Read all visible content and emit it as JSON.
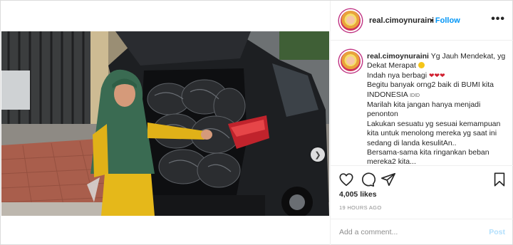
{
  "post": {
    "username": "real.cimoynuraini",
    "follow_separator": "•",
    "follow_label": "Follow",
    "more_icon": "•••",
    "carousel": {
      "slides": 4,
      "active_index": 0,
      "next_icon": "chevron-right-icon"
    }
  },
  "caption": {
    "username": "real.cimoynuraini",
    "line1": "Yg Jauh Mendekat, yg Dekat Merapat",
    "line2": "Indah nya berbagi",
    "line3": "Begitu banyak orng2 baik di BUMI kita INDONESIA",
    "flag_text": "IDID",
    "line4": "Marilah kita jangan hanya menjadi penonton",
    "line5": "Lakukan sesuatu yg sesuai kemampuan kita untuk menolong mereka yg saat ini sedang di landa kesulitAn..",
    "line6": "Bersama-sama kita ringankan beban mereka2 kita..."
  },
  "actions": {
    "icons": [
      "heart-icon",
      "comment-icon",
      "share-icon",
      "bookmark-icon"
    ]
  },
  "stats": {
    "likes": "4,005 likes",
    "time": "19 HOURS AGO"
  },
  "comment": {
    "placeholder": "Add a comment...",
    "post_label": "Post"
  },
  "colors": {
    "accent": "#0095f6",
    "post_disabled": "#b2dffc",
    "heart": "#d11f2f"
  }
}
